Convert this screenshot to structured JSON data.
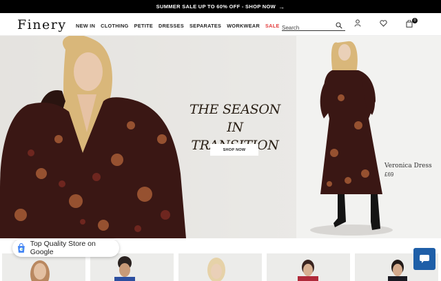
{
  "promo": {
    "text": "SUMMER SALE UP TO 60% OFF - SHOP NOW",
    "arrow": "→"
  },
  "header": {
    "logo": "Finery",
    "nav": [
      "NEW IN",
      "CLOTHING",
      "PETITE",
      "DRESSES",
      "SEPARATES",
      "WORKWEAR",
      "SALE"
    ],
    "search_placeholder": "Search",
    "bag_count": "0"
  },
  "hero": {
    "title_line1": "THE SEASON IN",
    "title_line2": "TRANSITION",
    "cta": "SHOP NOW",
    "product_name": "Veronica Dress",
    "product_price": "£69"
  },
  "badge": {
    "text_main": "Top Quality Store",
    "text_suffix": " on Google"
  },
  "colors": {
    "sale": "#e33b3b",
    "chat": "#1f5fa8",
    "promo_bg": "#000000"
  },
  "icons": [
    "search-icon",
    "account-icon",
    "heart-icon",
    "bag-icon",
    "chat-icon",
    "google-shopping-icon"
  ]
}
